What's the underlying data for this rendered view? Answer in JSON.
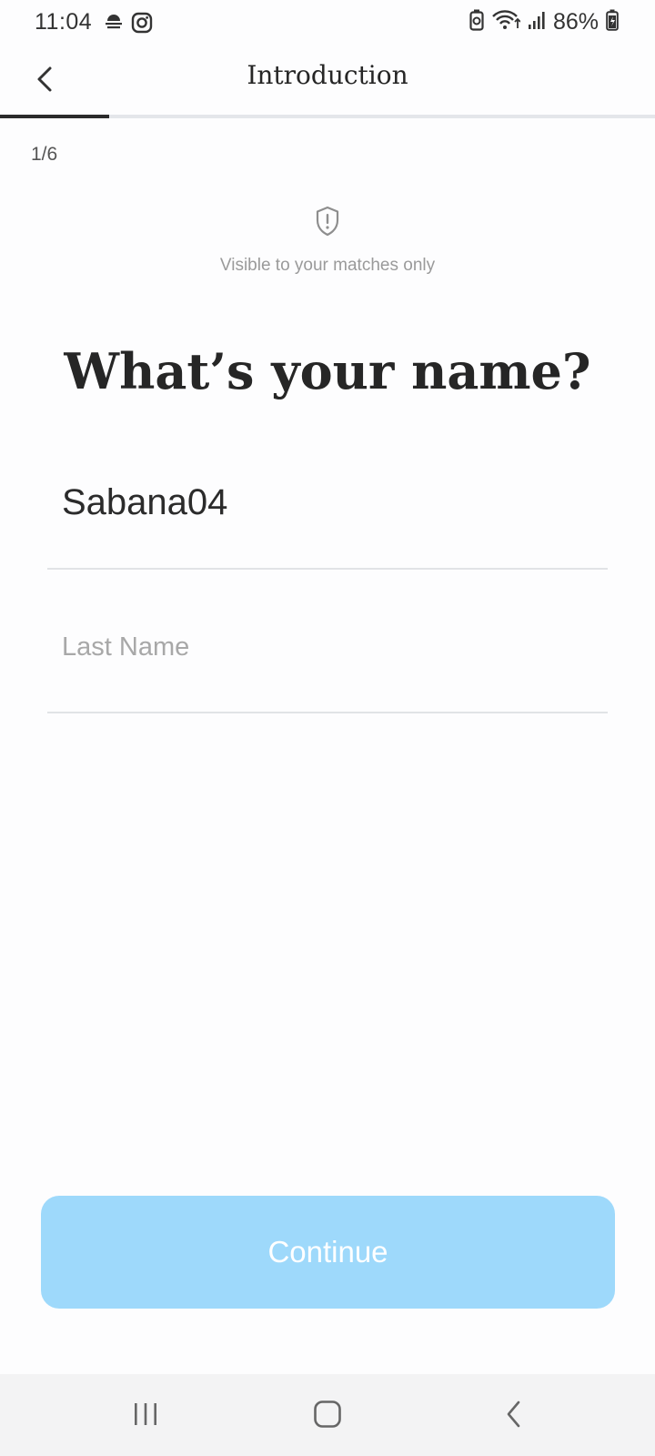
{
  "status_bar": {
    "time": "11:04",
    "battery_percent": "86%",
    "left_icons": [
      "weather-icon",
      "instagram-icon"
    ],
    "right_icons": [
      "battery-saver-icon",
      "wifi-icon",
      "signal-icon",
      "battery-icon"
    ]
  },
  "header": {
    "title": "Introduction",
    "back_icon": "chevron-left-icon"
  },
  "progress": {
    "step_label": "1/6",
    "fraction": 0.1667
  },
  "privacy": {
    "icon": "shield-alert-icon",
    "text": "Visible to your matches only"
  },
  "question": "What’s your name?",
  "form": {
    "first_name_value": "Sabana04",
    "last_name_placeholder": "Last Name",
    "last_name_value": ""
  },
  "continue_button": {
    "label": "Continue",
    "color": "#9ed9fb"
  },
  "nav_bar": {
    "items": [
      "recents-icon",
      "home-icon",
      "back-icon"
    ]
  },
  "colors": {
    "background": "#fdfdfe",
    "progress_fill": "#2b2b2b",
    "progress_track": "#e4e6ea"
  }
}
